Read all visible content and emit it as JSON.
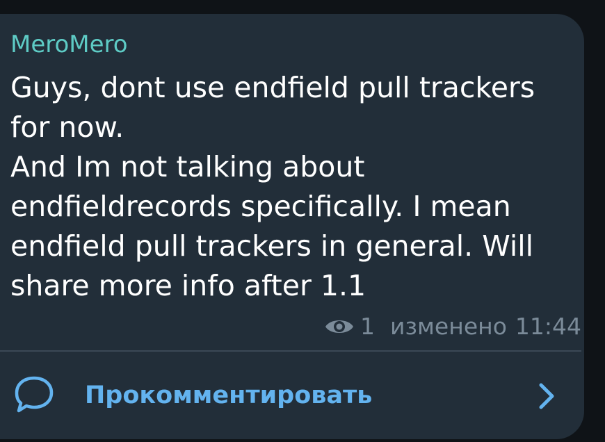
{
  "message": {
    "sender": "MeroMero",
    "text": "Guys, dont use endfield pull trackers for now.\nAnd Im not talking about endfieldrecords specifically. I mean endfield pull trackers in general. Will share more info after 1.1",
    "views": "1",
    "edited_label": "изменено",
    "time": "11:44"
  },
  "comments": {
    "label": "Прокомментировать",
    "icon": "comment-bubble-icon",
    "chevron": "chevron-right-icon"
  },
  "colors": {
    "bubble": "#222e39",
    "background": "#0f1317",
    "sender": "#5ecbc5",
    "text": "#ffffff",
    "meta": "#7b8b99",
    "accent": "#63b3ef"
  }
}
